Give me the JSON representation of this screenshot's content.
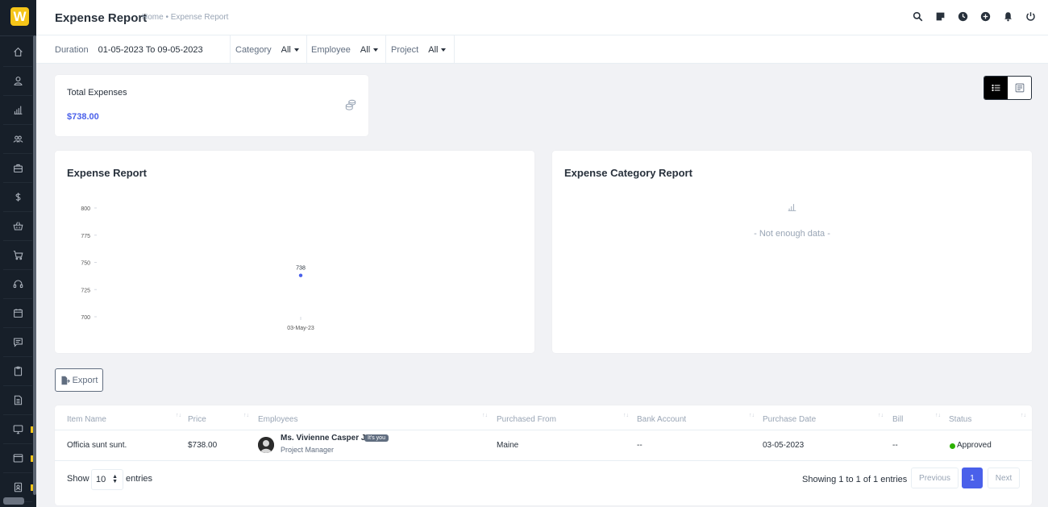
{
  "header": {
    "title": "Expense Report",
    "breadcrumb": "Home • Expense Report"
  },
  "filters": {
    "duration_label": "Duration",
    "duration_value": "01-05-2023 To 09-05-2023",
    "category_label": "Category",
    "category_value": "All",
    "employee_label": "Employee",
    "employee_value": "All",
    "project_label": "Project",
    "project_value": "All"
  },
  "summary": {
    "title": "Total Expenses",
    "value": "$738.00"
  },
  "expense_chart": {
    "heading": "Expense Report"
  },
  "chart_data": {
    "type": "scatter",
    "categories": [
      "03-May-23"
    ],
    "values": [
      738
    ],
    "data_labels": [
      "738"
    ],
    "y_ticks": [
      "800",
      "775",
      "750",
      "725",
      "700"
    ],
    "ylim": [
      700,
      800
    ],
    "color": "#4a60ea"
  },
  "category_chart": {
    "heading": "Expense Category Report",
    "empty_text": "- Not enough data -"
  },
  "actions": {
    "export_label": "Export"
  },
  "table": {
    "headers": [
      "Item Name",
      "Price",
      "Employees",
      "Purchased From",
      "Bank Account",
      "Purchase Date",
      "Bill",
      "Status"
    ],
    "rows": [
      {
        "item": "Officia sunt sunt.",
        "price": "$738.00",
        "employee_name": "Ms. Vivienne Casper Jr.",
        "employee_badge": "It's you",
        "employee_role": "Project Manager",
        "purchased_from": "Maine",
        "bank_account": "--",
        "purchase_date": "03-05-2023",
        "bill": "--",
        "status": "Approved"
      }
    ],
    "footer": {
      "show_label": "Show",
      "entries_value": "10",
      "entries_label": "entries",
      "showing_text": "Showing 1 to 1 of 1 entries",
      "previous_label": "Previous",
      "current_page": "1",
      "next_label": "Next"
    }
  },
  "colors": {
    "accent": "#4a60ea",
    "sidebar": "#171f29",
    "status_approved": "#2cb100",
    "logo": "#f5c518"
  }
}
